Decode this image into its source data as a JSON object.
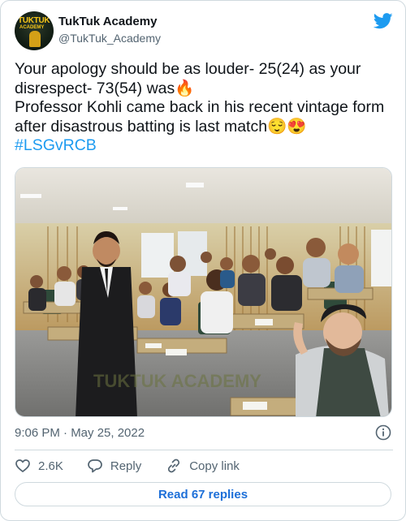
{
  "account": {
    "name": "TukTuk Academy",
    "handle": "@TukTuk_Academy",
    "avatar_logo": "TUKTUK",
    "avatar_logo_sub": "ACADEMY"
  },
  "tweet": {
    "line1": "Your apology should be as louder- 25(24) as your disrespect- 73(54) was🔥",
    "line2": "Professor Kohli came back in his recent vintage form after disastrous batting is last match😌😍",
    "hashtag": "#LSGvRCB"
  },
  "photo": {
    "watermark": "TUKTUK ACADEMY"
  },
  "meta": {
    "timestamp": "9:06 PM · May 25, 2022"
  },
  "actions": {
    "likes": "2.6K",
    "reply_label": "Reply",
    "copy_label": "Copy link"
  },
  "replies_button": "Read 67 replies",
  "icons": {
    "brand": "twitter-bird-icon",
    "info": "info-icon",
    "like": "heart-icon",
    "reply": "speech-bubble-icon",
    "copy": "link-icon"
  },
  "colors": {
    "accent": "#1d9bf0",
    "link": "#1d6fd8",
    "text": "#0f1419",
    "muted": "#536471",
    "border": "#cfd9de"
  }
}
